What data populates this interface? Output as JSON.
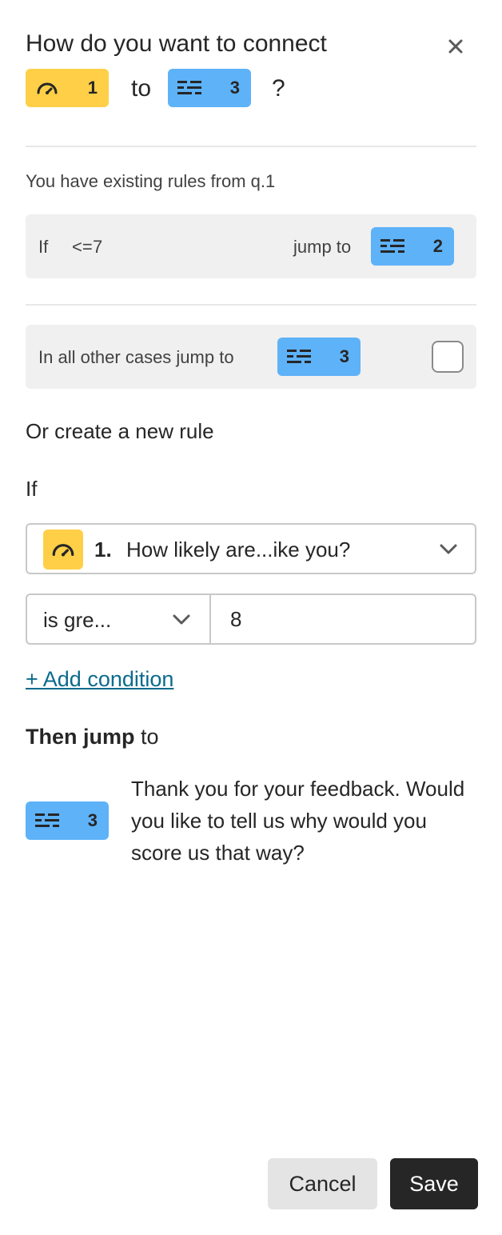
{
  "modal": {
    "title": "How do you want to connect",
    "from_badge": {
      "icon": "gauge-icon",
      "number": "1",
      "color": "#fecf47"
    },
    "to_word": "to",
    "to_badge": {
      "icon": "text-lines-icon",
      "number": "3",
      "color": "#5eb2f8"
    },
    "question_mark": "?",
    "close_icon": "close-icon"
  },
  "existing": {
    "label": "You have existing rules from q.1",
    "rule": {
      "if_label": "If",
      "operator": "<=",
      "value": "7",
      "jump_label": "jump to",
      "target_number": "2",
      "target_icon": "text-lines-icon"
    },
    "fallback": {
      "label": "In all other cases jump to",
      "target_number": "3",
      "target_icon": "text-lines-icon",
      "checked": false
    }
  },
  "new_rule": {
    "heading": "Or create a new rule",
    "if_label": "If",
    "question": {
      "number": "1.",
      "text": "How likely are...ike you?",
      "icon": "gauge-icon"
    },
    "condition": {
      "operator": "is gre...",
      "value": "8"
    },
    "add_condition": "+ Add condition",
    "then_bold": "Then jump",
    "then_rest": " to",
    "target": {
      "number": "3",
      "icon": "text-lines-icon",
      "text": "Thank you for your feedback. Would you like to tell us why would you score us that way?"
    }
  },
  "footer": {
    "cancel": "Cancel",
    "save": "Save"
  },
  "colors": {
    "yellow": "#fecf47",
    "blue": "#5eb2f8",
    "link": "#0a6b8c",
    "dark": "#262627"
  }
}
